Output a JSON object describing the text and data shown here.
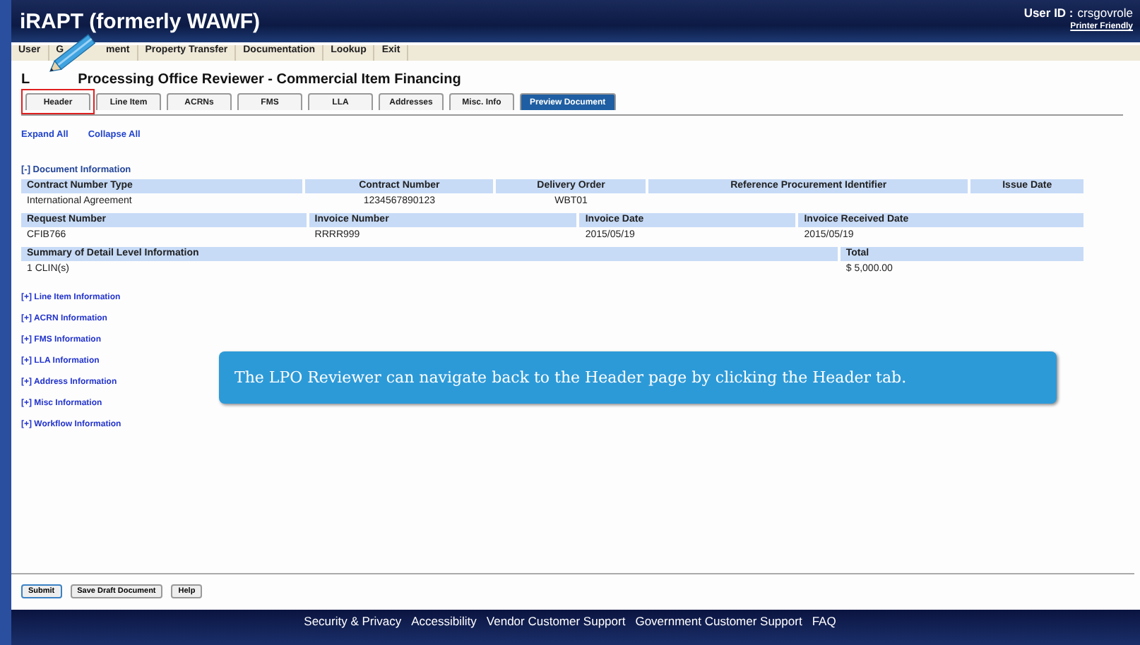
{
  "header": {
    "title": "iRAPT (formerly WAWF)",
    "user_label": "User ID :",
    "user_id": "crsgovrole",
    "printer_link": "Printer Friendly"
  },
  "menu": [
    {
      "label": "User"
    },
    {
      "label": "G",
      "label_end": "ment"
    },
    {
      "label": "Property Transfer"
    },
    {
      "label": "Documentation"
    },
    {
      "label": "Lookup"
    },
    {
      "label": "Exit"
    }
  ],
  "page_title": {
    "start": "L",
    "end": "Processing Office Reviewer - Commercial Item Financing"
  },
  "tabs": [
    {
      "label": "Header",
      "selected": false,
      "highlighted": true
    },
    {
      "label": "Line Item",
      "selected": false,
      "highlighted": false
    },
    {
      "label": "ACRNs",
      "selected": false,
      "highlighted": false
    },
    {
      "label": "FMS",
      "selected": false,
      "highlighted": false
    },
    {
      "label": "LLA",
      "selected": false,
      "highlighted": false
    },
    {
      "label": "Addresses",
      "selected": false,
      "highlighted": false
    },
    {
      "label": "Misc. Info",
      "selected": false,
      "highlighted": false
    },
    {
      "label": "Preview Document",
      "selected": true,
      "highlighted": false
    }
  ],
  "expand_links": [
    "Expand All",
    "Collapse All"
  ],
  "document_section": "[-] Document Information",
  "tables": [
    {
      "columns": [
        "Contract Number Type",
        "Contract Number",
        "Delivery Order",
        "Reference Procurement Identifier",
        "Issue Date"
      ],
      "row": [
        "International Agreement",
        "1234567890123",
        "WBT01"
      ]
    },
    {
      "columns": [
        "Request Number",
        "Invoice Number",
        "Invoice Date",
        "Invoice Received Date"
      ],
      "row": [
        "CFIB766",
        "RRRR999",
        "2015/05/19",
        "2015/05/19"
      ]
    },
    {
      "columns": [
        "Summary of Detail Level Information",
        "Total"
      ],
      "row": [
        "1 CLIN(s)",
        "$ 5,000.00"
      ]
    }
  ],
  "sections": [
    "[+] Line Item Information",
    "[+] ACRN Information",
    "[+] FMS Information",
    "[+] LLA Information",
    "[+] Address Information",
    "[+] Misc Information",
    "[+] Workflow Information"
  ],
  "callout": "The LPO Reviewer can navigate back to the Header page by clicking the Header tab.",
  "buttons": [
    {
      "label": "Submit",
      "focused": true
    },
    {
      "label": "Save Draft Document",
      "focused": false
    },
    {
      "label": "Help",
      "focused": false
    }
  ],
  "footer_links": [
    "Security & Privacy",
    "Accessibility",
    "Vendor Customer Support",
    "Government Customer Support",
    "FAQ"
  ]
}
